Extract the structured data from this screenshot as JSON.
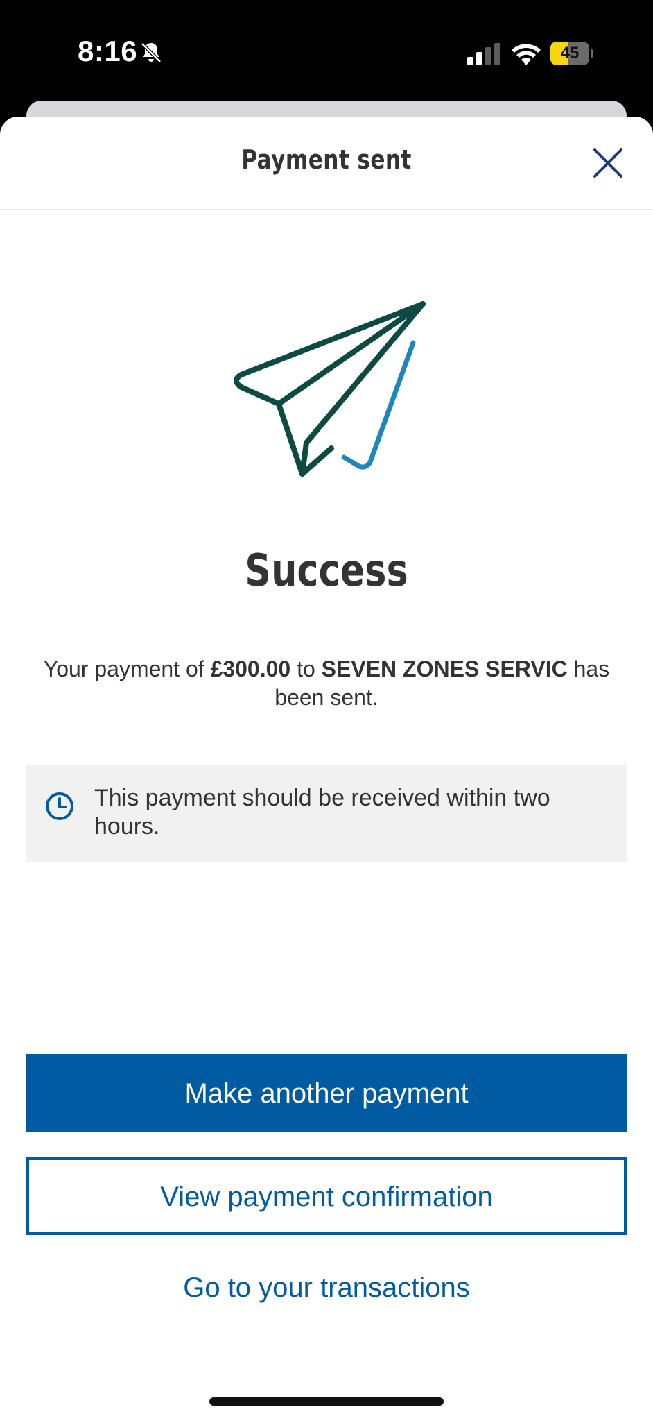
{
  "status_bar": {
    "time": "8:16",
    "battery_level": "45",
    "battery_fraction": 0.45,
    "icons": [
      "bell-slash-icon",
      "cellular-signal-icon",
      "wifi-icon",
      "battery-icon"
    ]
  },
  "header": {
    "title": "Payment sent",
    "close_icon": "close-icon"
  },
  "hero": {
    "icon": "paper-plane-check-icon",
    "colors": {
      "plane": "#0d4a44",
      "check": "#1f86bd"
    }
  },
  "success": {
    "title": "Success",
    "message_prefix": "Your payment of ",
    "amount": "£300.00",
    "message_mid": " to ",
    "payee": "SEVEN ZONES SERVIC",
    "message_suffix": " has been sent."
  },
  "info": {
    "icon": "clock-icon",
    "text": "This payment should be received within two hours."
  },
  "actions": {
    "primary_label": "Make another payment",
    "secondary_label": "View payment confirmation",
    "link_label": "Go to your transactions"
  },
  "colors": {
    "brand": "#005ba3",
    "info_bg": "#f1f1f1",
    "text": "#333333"
  }
}
